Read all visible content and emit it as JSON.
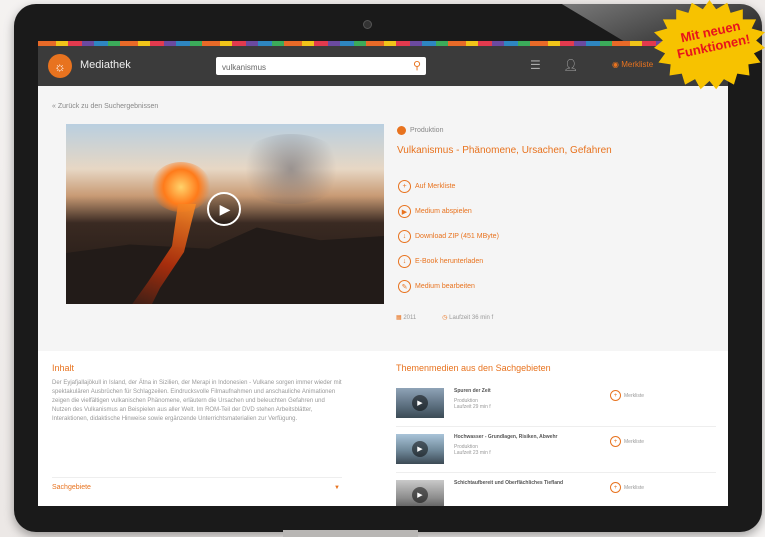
{
  "navbar": {
    "brand": "Mediathek",
    "search_value": "vulkanismus",
    "merkliste": "Merkliste"
  },
  "back_link": "« Zurück zu den Suchergebnissen",
  "product": {
    "badge": "Produktion",
    "title": "Vulkanismus - Phänomene, Ursachen, Gefahren",
    "actions": [
      {
        "label": "Auf Merkliste",
        "icon": "plus"
      },
      {
        "label": "Medium abspielen",
        "icon": "play"
      },
      {
        "label": "Download ZIP (451 MByte)",
        "icon": "download"
      },
      {
        "label": "E-Book herunterladen",
        "icon": "download"
      },
      {
        "label": "Medium bearbeiten",
        "icon": "pencil"
      }
    ],
    "year": "2011",
    "duration": "Laufzeit 36 min f"
  },
  "inhalt": {
    "heading": "Inhalt",
    "text": "Der Eyjafjallajökull in Island, der Ätna in Sizilien, der Merapi in Indonesien - Vulkane sorgen immer wieder mit spektakulären Ausbrüchen für Schlagzeilen. Eindrucksvolle Filmaufnahmen und anschauliche Animationen zeigen die vielfältigen vulkanischen Phänomene, erläutern die Ursachen und beleuchten Gefahren und Nutzen des Vulkanismus an Beispielen aus aller Welt. Im ROM-Teil der DVD stehen Arbeitsblätter, Interaktionen, didaktische Hinweise sowie ergänzende Unterrichtsmaterialien zur Verfügung.",
    "sachgebiete": "Sachgebiete"
  },
  "themenmedien": {
    "heading": "Themenmedien aus den Sachgebieten",
    "items": [
      {
        "title": "Spuren der Zeit",
        "type": "Produktion",
        "duration": "Laufzeit 29 min f",
        "merk": "Merkliste"
      },
      {
        "title": "Hochwasser - Grundlagen, Risiken, Abwehr",
        "type": "Produktion",
        "duration": "Laufzeit 23 min f",
        "merk": "Merkliste"
      },
      {
        "title": "Schichtaufbereit und Oberflächliches Tiefland",
        "type": "",
        "duration": "",
        "merk": "Merkliste"
      }
    ]
  },
  "promo": {
    "line1": "Mit neuen",
    "line2": "Funktionen!"
  },
  "colors": {
    "accent": "#e8731f",
    "promo": "#f7c200",
    "promo_text": "#e8131b"
  }
}
